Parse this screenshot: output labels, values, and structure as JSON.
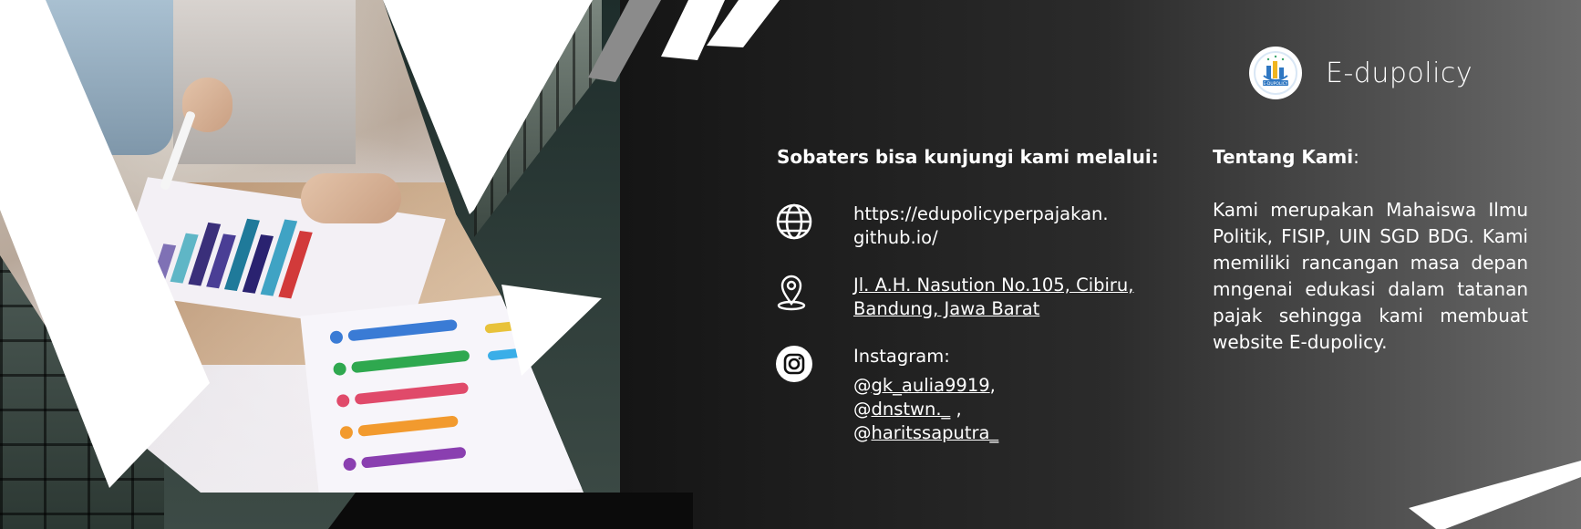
{
  "brand": {
    "name": "E-dupolicy",
    "logo_text": "E-DUPOLICY"
  },
  "visit": {
    "title": "Sobaters bisa kunjungi kami melalui:",
    "website_line1": "https://edupolicyperpajakan.",
    "website_line2": "github.io/",
    "address_line1": "Jl. A.H. Nasution No.105, Cibiru,",
    "address_line2": "Bandung, Jawa Barat",
    "instagram_label": "Instagram:",
    "instagram_handles": [
      {
        "handle": "gk_aulia9919",
        "suffix": ","
      },
      {
        "handle": "dnstwn._",
        "suffix": " ,"
      },
      {
        "handle": "haritssaputra_",
        "suffix": ""
      }
    ]
  },
  "about": {
    "title": "Tentang Kami",
    "colon": ":",
    "text": "Kami merupakan Mahaiswa Ilmu Politik, FISIP, UIN SGD BDG. Kami memiliki rancangan masa depan mngenai edukasi dalam tatanan pajak sehingga kami membuat website E-dupolicy."
  },
  "icons": [
    "globe-icon",
    "location-pin-icon",
    "instagram-icon"
  ],
  "colors": {
    "background_dark": "#0d0d0d",
    "background_light": "#6a6a6a",
    "text": "#ffffff",
    "accent_shapes": "#ffffff"
  }
}
